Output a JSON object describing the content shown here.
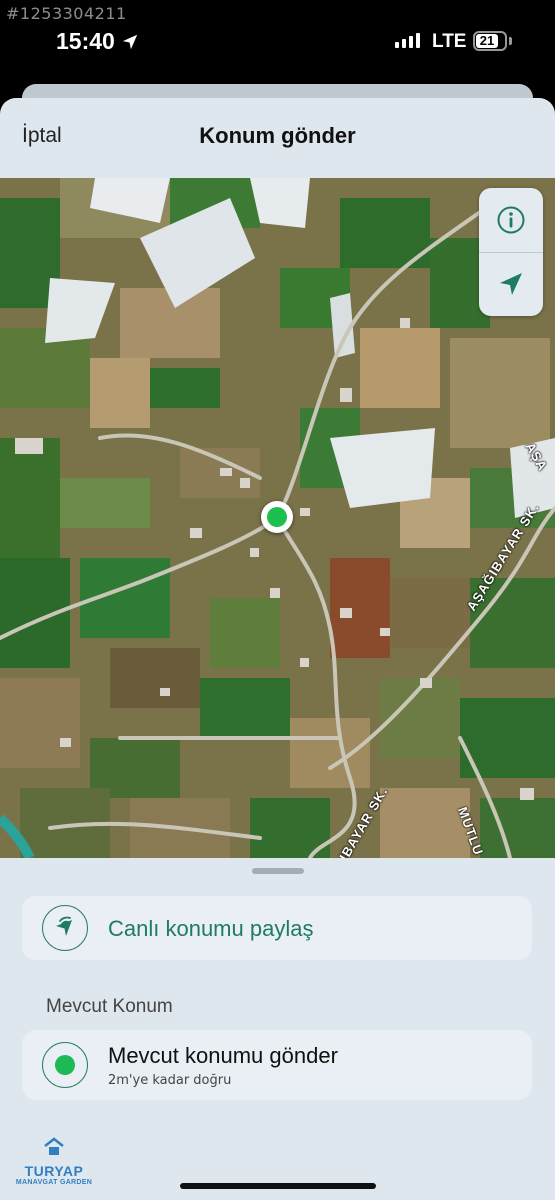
{
  "watermark": {
    "id_text": "#1253304211"
  },
  "status_bar": {
    "time": "15:40",
    "carrier": "LTE",
    "battery": "21"
  },
  "nav": {
    "cancel_label": "İptal",
    "title": "Konum gönder"
  },
  "map": {
    "info_icon": "info-icon",
    "locate_icon": "location-arrow-icon",
    "streets": [
      "AŞAĞIBAYAR SK.",
      "AŞAĞIBAYAR SK.",
      "MUTLU SELİM SK.",
      "AŞA"
    ]
  },
  "share_live": {
    "label": "Canlı konumu paylaş",
    "icon": "live-location-icon"
  },
  "current_location": {
    "section_title": "Mevcut Konum",
    "title": "Mevcut konumu gönder",
    "accuracy": "2m'ye kadar doğru"
  },
  "logo": {
    "name": "TURYAP",
    "sub": "MANAVGAT GARDEN"
  },
  "colors": {
    "accent": "#1f7a67",
    "pin": "#1dbf4f",
    "sheet": "#dfe7ee"
  }
}
